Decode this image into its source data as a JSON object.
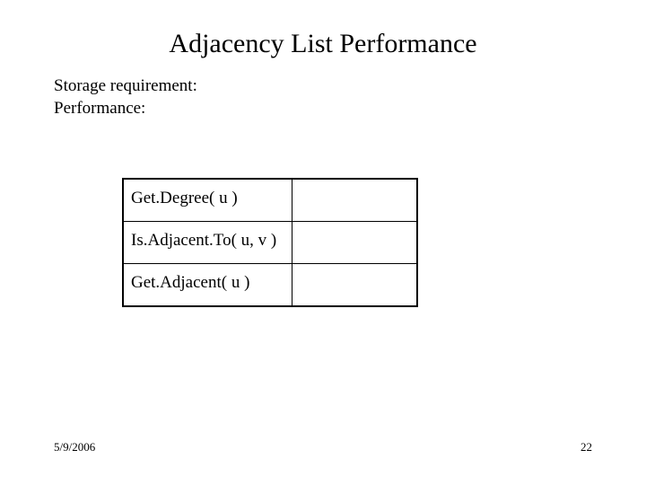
{
  "slide": {
    "title": "Adjacency List Performance",
    "storage_label": "Storage requirement:",
    "performance_label": "Performance:",
    "table": {
      "rows": [
        {
          "op": "Get.Degree( u )",
          "val": ""
        },
        {
          "op": "Is.Adjacent.To( u, v )",
          "val": ""
        },
        {
          "op": "Get.Adjacent( u )",
          "val": ""
        }
      ]
    },
    "footer_date": "5/9/2006",
    "footer_page": "22"
  }
}
